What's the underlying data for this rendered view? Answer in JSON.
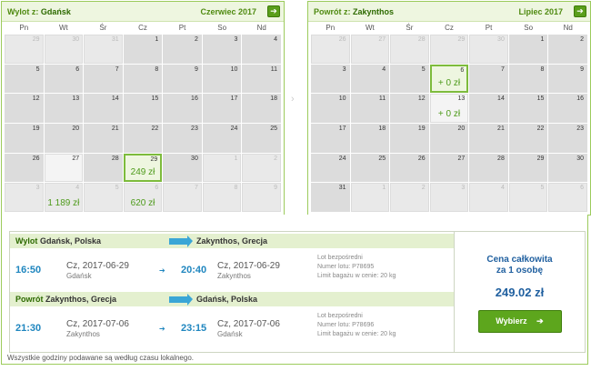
{
  "outbound": {
    "label": "Wylot z:",
    "city": "Gdańsk",
    "month": "Czerwiec 2017",
    "dow": [
      "Pn",
      "Wt",
      "Śr",
      "Cz",
      "Pt",
      "So",
      "Nd"
    ],
    "days": [
      {
        "n": "29",
        "out": true
      },
      {
        "n": "30",
        "out": true
      },
      {
        "n": "31",
        "out": true
      },
      {
        "n": "1"
      },
      {
        "n": "2"
      },
      {
        "n": "3"
      },
      {
        "n": "4"
      },
      {
        "n": "5"
      },
      {
        "n": "6"
      },
      {
        "n": "7"
      },
      {
        "n": "8"
      },
      {
        "n": "9"
      },
      {
        "n": "10"
      },
      {
        "n": "11"
      },
      {
        "n": "12"
      },
      {
        "n": "13"
      },
      {
        "n": "14"
      },
      {
        "n": "15"
      },
      {
        "n": "16"
      },
      {
        "n": "17"
      },
      {
        "n": "18"
      },
      {
        "n": "19"
      },
      {
        "n": "20"
      },
      {
        "n": "21"
      },
      {
        "n": "22"
      },
      {
        "n": "23"
      },
      {
        "n": "24"
      },
      {
        "n": "25"
      },
      {
        "n": "26"
      },
      {
        "n": "27",
        "avail": true
      },
      {
        "n": "28"
      },
      {
        "n": "29",
        "price": "249 zł",
        "sel": true
      },
      {
        "n": "30"
      },
      {
        "n": "1",
        "out": true
      },
      {
        "n": "2",
        "out": true
      },
      {
        "n": "3",
        "out": true
      },
      {
        "n": "4",
        "out": true,
        "price": "1 189 zł"
      },
      {
        "n": "5",
        "out": true
      },
      {
        "n": "6",
        "out": true,
        "price": "620 zł"
      },
      {
        "n": "7",
        "out": true
      },
      {
        "n": "8",
        "out": true
      },
      {
        "n": "9",
        "out": true
      }
    ]
  },
  "return": {
    "label": "Powrót z:",
    "city": "Zakynthos",
    "month": "Lipiec 2017",
    "dow": [
      "Pn",
      "Wt",
      "Śr",
      "Cz",
      "Pt",
      "So",
      "Nd"
    ],
    "days": [
      {
        "n": "26",
        "out": true
      },
      {
        "n": "27",
        "out": true
      },
      {
        "n": "28",
        "out": true
      },
      {
        "n": "29",
        "out": true
      },
      {
        "n": "30",
        "out": true
      },
      {
        "n": "1"
      },
      {
        "n": "2"
      },
      {
        "n": "3"
      },
      {
        "n": "4"
      },
      {
        "n": "5"
      },
      {
        "n": "6",
        "price": "+ 0 zł",
        "sel": true
      },
      {
        "n": "7"
      },
      {
        "n": "8"
      },
      {
        "n": "9"
      },
      {
        "n": "10"
      },
      {
        "n": "11"
      },
      {
        "n": "12"
      },
      {
        "n": "13",
        "price": "+ 0 zł",
        "avail": true
      },
      {
        "n": "14"
      },
      {
        "n": "15"
      },
      {
        "n": "16"
      },
      {
        "n": "17"
      },
      {
        "n": "18"
      },
      {
        "n": "19"
      },
      {
        "n": "20"
      },
      {
        "n": "21"
      },
      {
        "n": "22"
      },
      {
        "n": "23"
      },
      {
        "n": "24"
      },
      {
        "n": "25"
      },
      {
        "n": "26"
      },
      {
        "n": "27"
      },
      {
        "n": "28"
      },
      {
        "n": "29"
      },
      {
        "n": "30"
      },
      {
        "n": "31"
      },
      {
        "n": "1",
        "out": true
      },
      {
        "n": "2",
        "out": true
      },
      {
        "n": "3",
        "out": true
      },
      {
        "n": "4",
        "out": true
      },
      {
        "n": "5",
        "out": true
      },
      {
        "n": "6",
        "out": true
      }
    ]
  },
  "trip": {
    "out_label": "Wylot",
    "out_from": "Gdańsk, Polska",
    "out_to": "Zakynthos, Grecja",
    "out_dep_time": "16:50",
    "out_dep_date": "Cz, 2017-06-29",
    "out_dep_city": "Gdańsk",
    "out_arr_time": "20:40",
    "out_arr_date": "Cz, 2017-06-29",
    "out_arr_city": "Zakynthos",
    "out_meta1": "Lot bezpośredni",
    "out_meta2": "Numer lotu: P78695",
    "out_meta3": "Limit bagażu w cenie: 20 kg",
    "ret_label": "Powrót",
    "ret_from": "Zakynthos, Grecja",
    "ret_to": "Gdańsk, Polska",
    "ret_dep_time": "21:30",
    "ret_dep_date": "Cz, 2017-07-06",
    "ret_dep_city": "Zakynthos",
    "ret_arr_time": "23:15",
    "ret_arr_date": "Cz, 2017-07-06",
    "ret_arr_city": "Gdańsk",
    "ret_meta1": "Lot bezpośredni",
    "ret_meta2": "Numer lotu: P78696",
    "ret_meta3": "Limit bagażu w cenie: 20 kg"
  },
  "price": {
    "title1": "Cena całkowita",
    "title2": "za 1 osobę",
    "value": "249.02 zł",
    "button": "Wybierz",
    "button_icon": "➔"
  },
  "footer": "Wszystkie godziny podawane są według czasu lokalnego.",
  "icons": {
    "next": "➔",
    "mid": "›",
    "small": "➔"
  }
}
